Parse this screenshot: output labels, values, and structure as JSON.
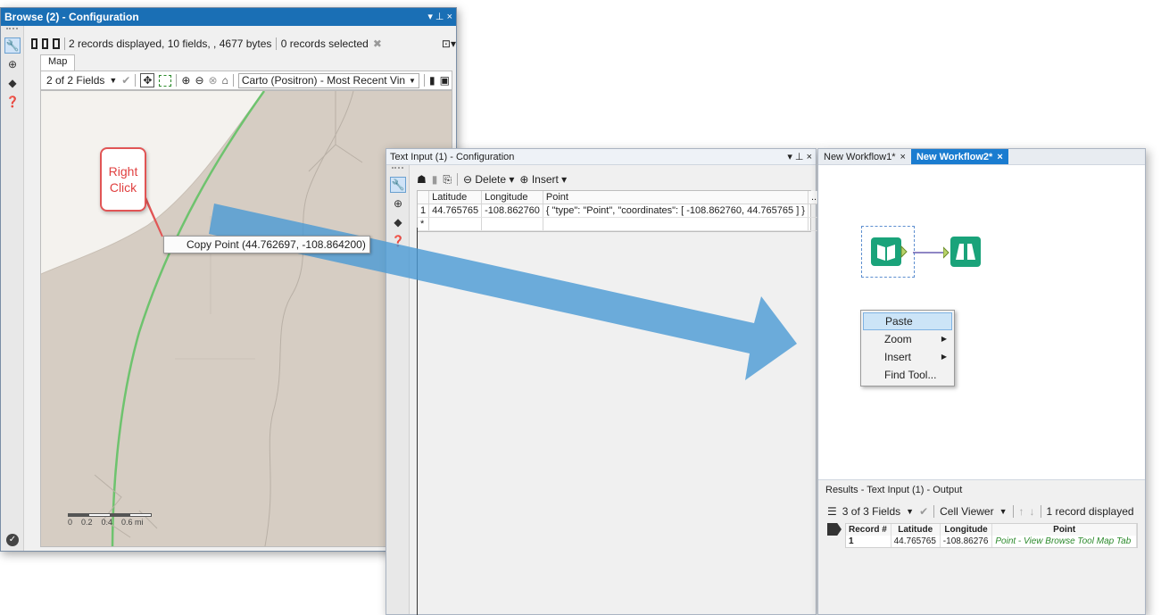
{
  "browse": {
    "title": "Browse (2) - Configuration",
    "title_controls": "▾ ⊥ ×",
    "summary": "2 records displayed, 10 fields, , 4677 bytes",
    "selected": "0 records selected",
    "tab": "Map",
    "fields_dropdown": "2 of 2 Fields",
    "basemap": "Carto (Positron) - Most Recent Vin",
    "scale_labels": [
      "0",
      "0.2",
      "0.4",
      "0.6 mi"
    ],
    "colors": {
      "titlebar": "#1a6fb5",
      "map_land": "#d6cdc3",
      "road": "#6ec36e"
    }
  },
  "callout": {
    "text_line1": "Right",
    "text_line2": "Click"
  },
  "copy_menu": {
    "label": "Copy Point (44.762697, -108.864200)"
  },
  "text_input": {
    "title": "Text Input (1) - Configuration",
    "title_controls": "▾ ⊥ ×",
    "delete_label": "Delete",
    "insert_label": "Insert",
    "columns": [
      "",
      "Latitude",
      "Longitude",
      "Point",
      "..."
    ],
    "rows": [
      [
        "1",
        "44.765765",
        "-108.862760",
        "{ \"type\": \"Point\", \"coordinates\": [ -108.862760, 44.765765 ] }",
        ""
      ],
      [
        "*",
        "",
        "",
        "",
        ""
      ]
    ]
  },
  "workflow": {
    "tabs": [
      {
        "label": "New Workflow1*",
        "close": "×"
      },
      {
        "label": "New Workflow2*",
        "close": "×"
      }
    ],
    "context_menu": [
      {
        "label": "Paste",
        "submenu": false
      },
      {
        "label": "Zoom",
        "submenu": true
      },
      {
        "label": "Insert",
        "submenu": true
      },
      {
        "label": "Find Tool...",
        "submenu": false
      }
    ],
    "colors": {
      "tool_green": "#1aa37a",
      "tab_active": "#1a7cd0",
      "arrow_blue": "#4a9ad4"
    }
  },
  "results": {
    "title": "Results - Text Input (1) - Output",
    "fields_dropdown": "3 of 3 Fields",
    "viewer": "Cell Viewer",
    "count": "1 record displayed",
    "columns": [
      "Record #",
      "Latitude",
      "Longitude",
      "Point"
    ],
    "rows": [
      [
        "1",
        "44.765765",
        "-108.86276",
        "Point - View Browse Tool Map Tab"
      ]
    ]
  }
}
